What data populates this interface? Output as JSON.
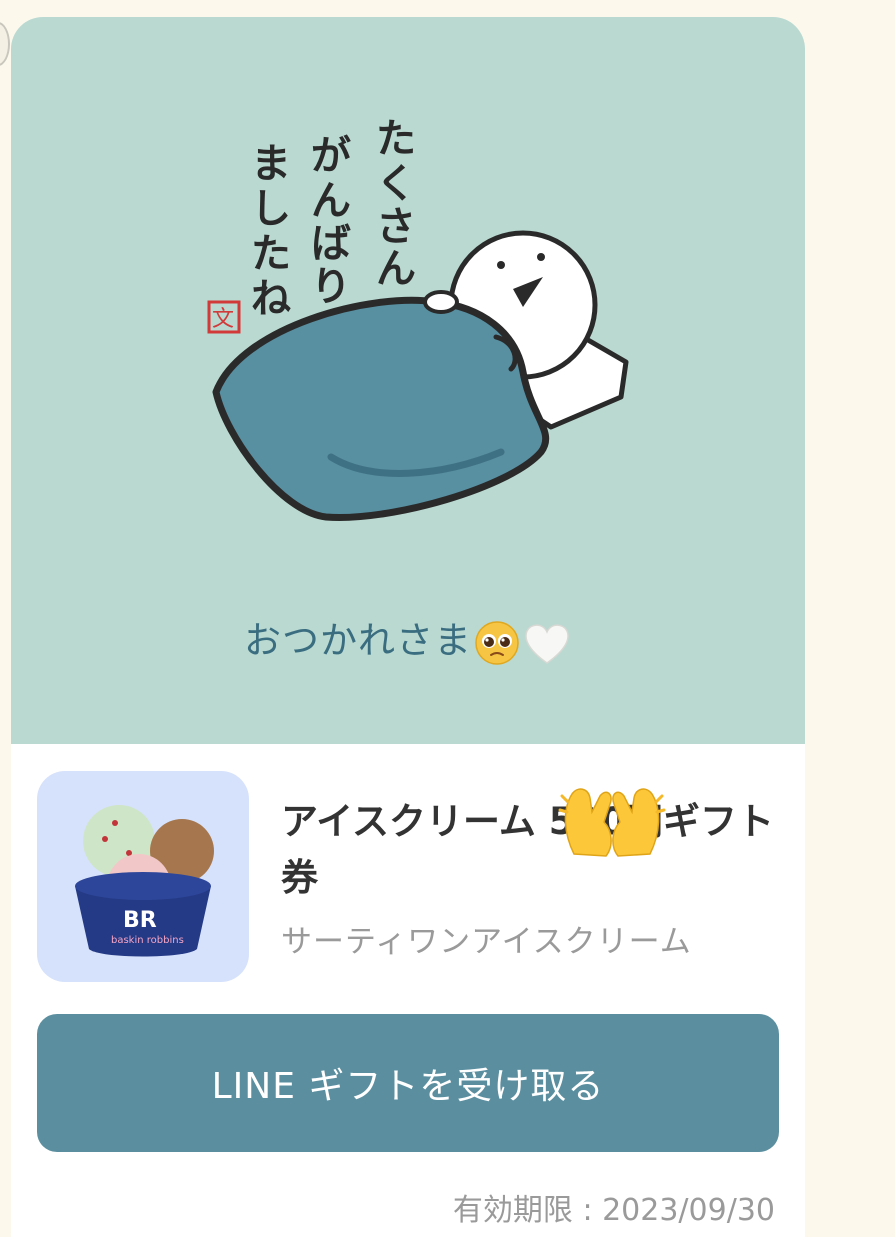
{
  "message": {
    "text": "おつかれさま",
    "emojis": [
      "pleading-face-icon",
      "white-heart-icon"
    ]
  },
  "sticker": {
    "text": "たくさん がんばり ましたね",
    "stamp_char": "文",
    "icon": "sticker-icon"
  },
  "gift": {
    "name": "アイスクリーム 500円ギフト券",
    "brand": "サーティワンアイスクリーム",
    "thumbnail_icon": "ice-cream-cup-icon",
    "overlay_emoji": "raising-hands-icon",
    "button_label": "LINE ギフトを受け取る",
    "expiry": "有効期限 : 2023/09/30"
  },
  "colors": {
    "hero_bg": "#b9d9d1",
    "button_bg": "#5b8fa0",
    "message_text": "#3a6d80",
    "page_bg": "#fcf9ec",
    "thumb_bg": "#d6e2fb"
  }
}
